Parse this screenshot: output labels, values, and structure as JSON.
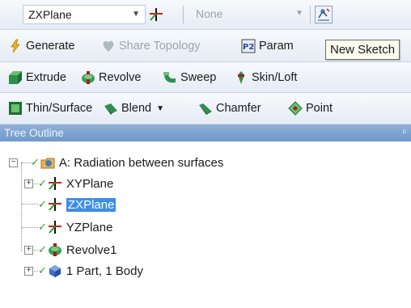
{
  "toolbar_row1": {
    "plane_select": "ZXPlane",
    "sketch_select": "None",
    "icons": [
      "axis-icon",
      "new-sketch-icon"
    ]
  },
  "toolbar_row2": {
    "generate": "Generate",
    "share_topology": "Share Topology",
    "parameters": "Param",
    "tooltip": "New Sketch"
  },
  "toolbar_row3": {
    "extrude": "Extrude",
    "revolve": "Revolve",
    "sweep": "Sweep",
    "skin_loft": "Skin/Loft"
  },
  "toolbar_row4": {
    "thin_surface": "Thin/Surface",
    "blend": "Blend",
    "chamfer": "Chamfer",
    "point": "Point"
  },
  "tree": {
    "header": "Tree Outline",
    "root": "A: Radiation between surfaces",
    "items": [
      {
        "label": "XYPlane",
        "icon": "plane-axis-icon"
      },
      {
        "label": "ZXPlane",
        "icon": "plane-axis-icon",
        "selected": true
      },
      {
        "label": "YZPlane",
        "icon": "plane-axis-icon"
      },
      {
        "label": "Revolve1",
        "icon": "revolve-icon"
      },
      {
        "label": "1 Part, 1 Body",
        "icon": "body-icon"
      }
    ]
  },
  "colors": {
    "toolbar_bg": "#e9eef6",
    "tree_header_bg": "#7a9fcf",
    "selection": "#3d8ee6",
    "check": "#2e9e2e"
  }
}
